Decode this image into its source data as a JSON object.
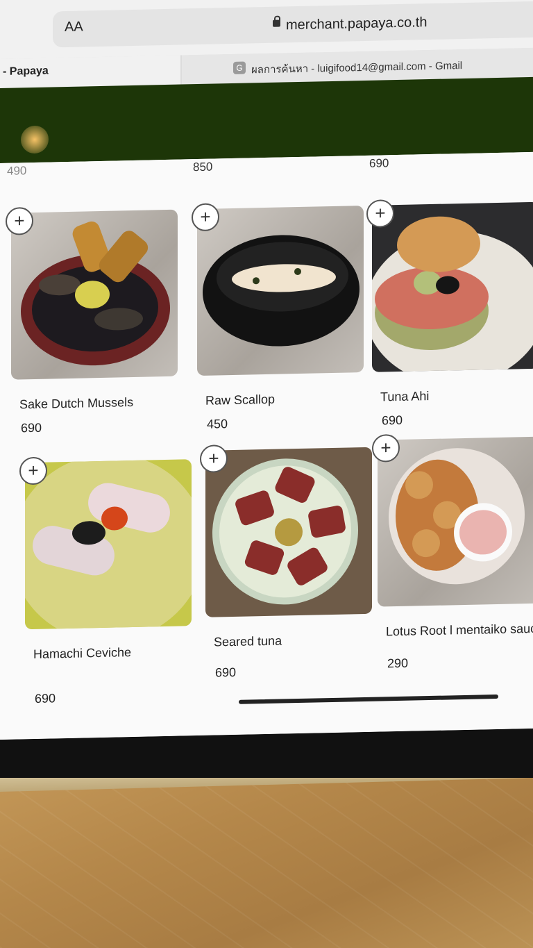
{
  "browser": {
    "text_size_label": "AA",
    "url": "merchant.papaya.co.th",
    "tabs": [
      {
        "label": "- Papaya"
      },
      {
        "icon_letter": "G",
        "label": "ผลการค้นหา - luigifood14@gmail.com - Gmail"
      }
    ]
  },
  "top_row_prices": [
    "490",
    "850",
    "690"
  ],
  "menu_items": [
    {
      "name": "Sake Dutch Mussels",
      "price": "690"
    },
    {
      "name": "Raw Scallop",
      "price": "450"
    },
    {
      "name": "Tuna Ahi",
      "price": "690"
    },
    {
      "name": "Hamachi Ceviche",
      "price": "690"
    },
    {
      "name": "Seared tuna",
      "price": "690"
    },
    {
      "name": "Lotus Root l mentaiko sauce",
      "price": "290"
    }
  ],
  "add_button_symbol": "+",
  "colors": {
    "header": "#1d3608",
    "card_text": "#222222",
    "background": "#fafafa"
  }
}
